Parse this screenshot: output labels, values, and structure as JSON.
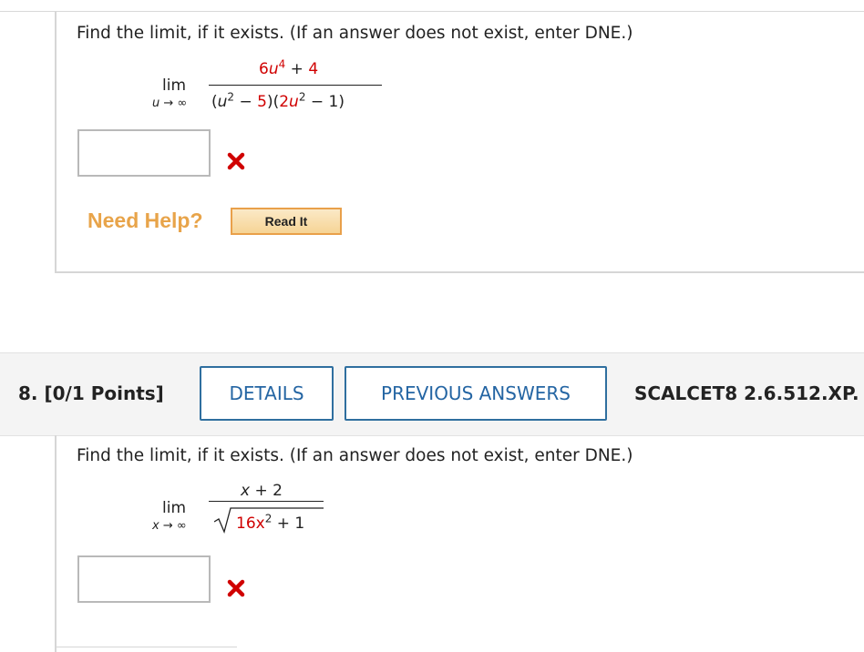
{
  "q7": {
    "prompt": "Find the limit, if it exists. (If an answer does not exist, enter DNE.)",
    "lim_label": "lim",
    "lim_under": "u → ∞",
    "numerator": {
      "coef_var": "6u",
      "exp": "4",
      "rest": " + 4"
    },
    "denominator": "(u² − 5)(2u² − 1)",
    "answer_value": "",
    "answer_status": "incorrect"
  },
  "help": {
    "label": "Need Help?",
    "read_it": "Read It"
  },
  "q8": {
    "number_label": "8.  [0/1 Points]",
    "details_label": "DETAILS",
    "prev_answers_label": "PREVIOUS ANSWERS",
    "code": "SCALCET8 2.6.512.XP.",
    "prompt": "Find the limit, if it exists. (If an answer does not exist, enter DNE.)",
    "lim_label": "lim",
    "lim_under": "x → ∞",
    "numerator": "x + 2",
    "radicand_red": "16x",
    "radicand_exp": "2",
    "radicand_rest": " + 1",
    "answer_value": "",
    "answer_status": "incorrect"
  },
  "colors": {
    "accent": "#2465a3",
    "incorrect": "#d00000",
    "help": "#e8a44a"
  }
}
